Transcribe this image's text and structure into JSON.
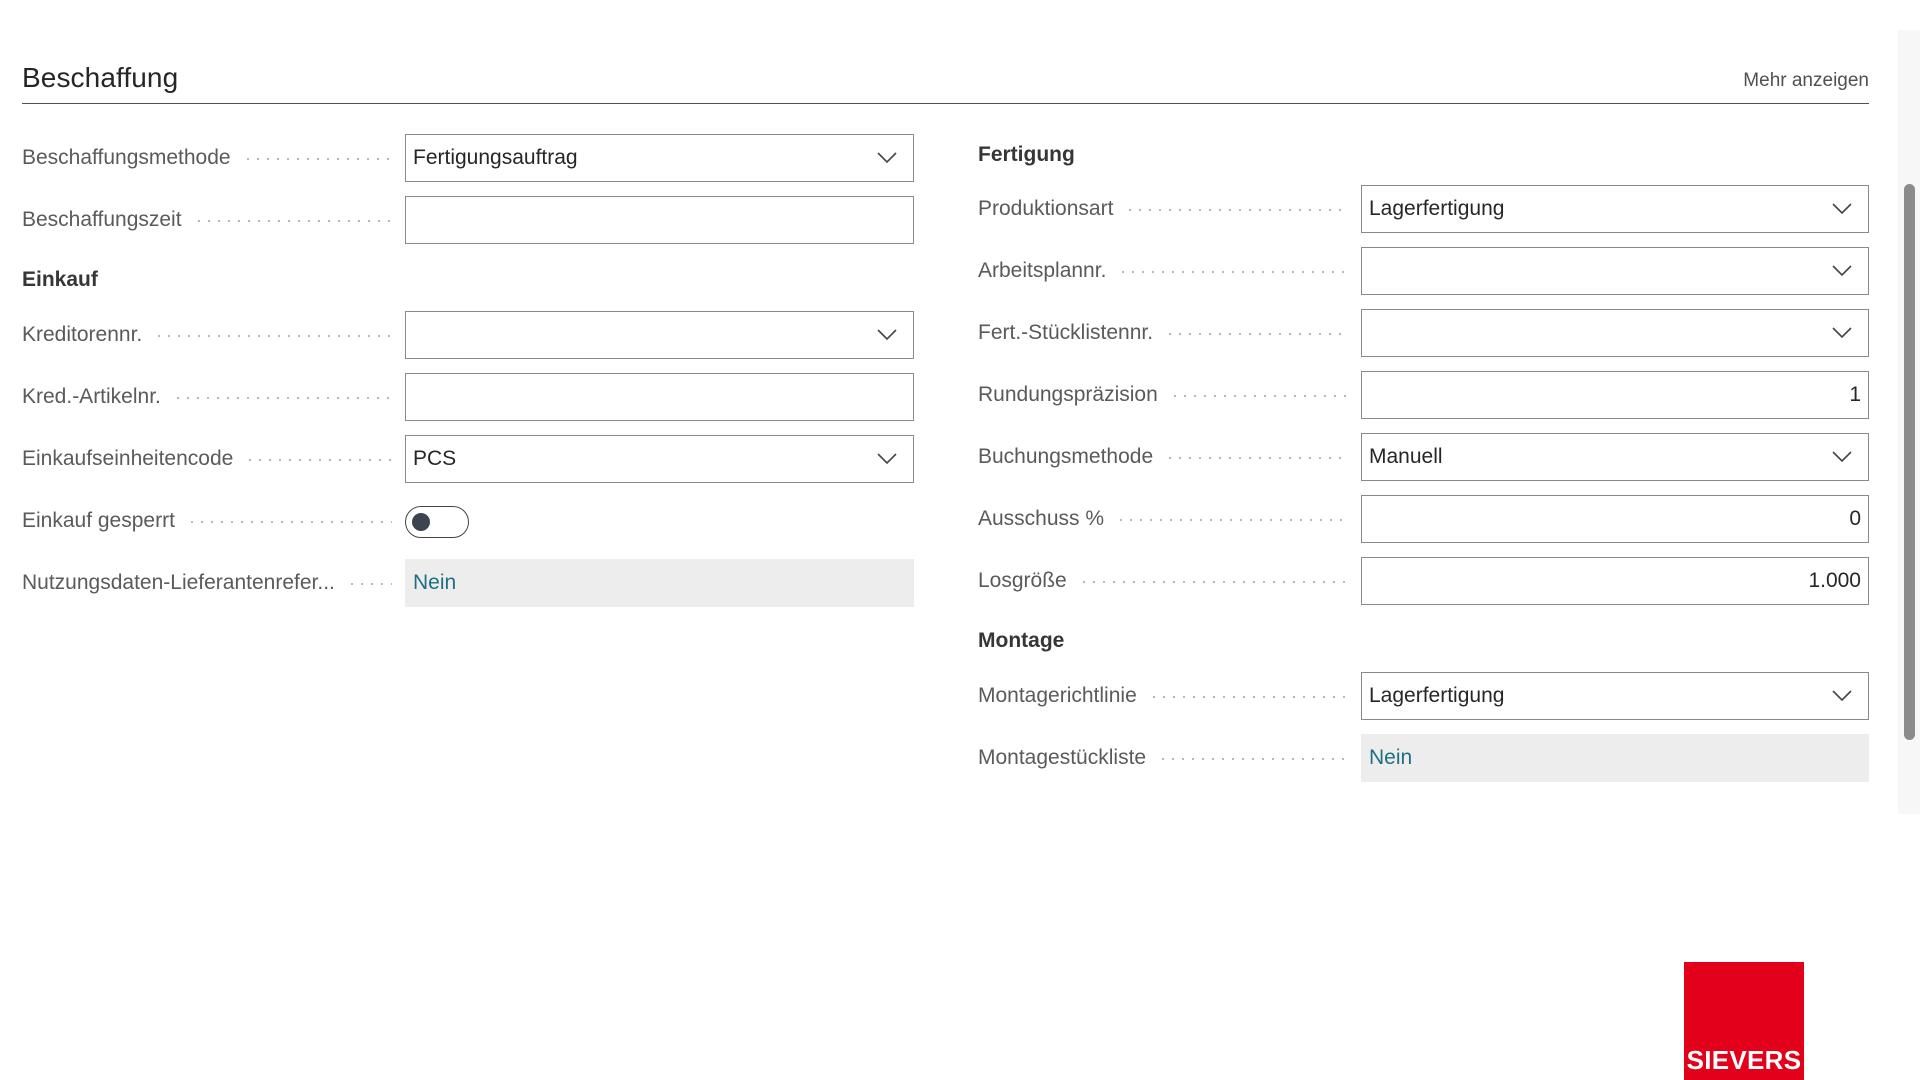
{
  "section": {
    "title": "Beschaffung",
    "show_more": "Mehr anzeigen"
  },
  "left": {
    "fields": [
      {
        "label": "Beschaffungsmethode",
        "value": "Fertigungsauftrag"
      },
      {
        "label": "Beschaffungszeit",
        "value": ""
      }
    ],
    "einkauf_heading": "Einkauf",
    "einkauf_fields": [
      {
        "label": "Kreditorennr.",
        "value": ""
      },
      {
        "label": "Kred.-Artikelnr.",
        "value": ""
      },
      {
        "label": "Einkaufseinheitencode",
        "value": "PCS"
      },
      {
        "label": "Einkauf gesperrt",
        "value": false
      },
      {
        "label": "Nutzungsdaten-Lieferantenrefer...",
        "value": "Nein"
      }
    ]
  },
  "right": {
    "fertigung_heading": "Fertigung",
    "fertigung_fields": [
      {
        "label": "Produktionsart",
        "value": "Lagerfertigung"
      },
      {
        "label": "Arbeitsplannr.",
        "value": ""
      },
      {
        "label": "Fert.-Stücklistennr.",
        "value": ""
      },
      {
        "label": "Rundungspräzision",
        "value": "1"
      },
      {
        "label": "Buchungsmethode",
        "value": "Manuell"
      },
      {
        "label": "Ausschuss %",
        "value": "0"
      },
      {
        "label": "Losgröße",
        "value": "1.000"
      }
    ],
    "montage_heading": "Montage",
    "montage_fields": [
      {
        "label": "Montagerichtlinie",
        "value": "Lagerfertigung"
      },
      {
        "label": "Montagestückliste",
        "value": "Nein"
      }
    ]
  },
  "icons": {
    "dropdown": "chevron-down-icon"
  },
  "logo": {
    "text": "SIEVERS",
    "color": "#e2001a"
  },
  "colors": {
    "link": "#1f6f84",
    "readonly_bg": "#ededed"
  }
}
